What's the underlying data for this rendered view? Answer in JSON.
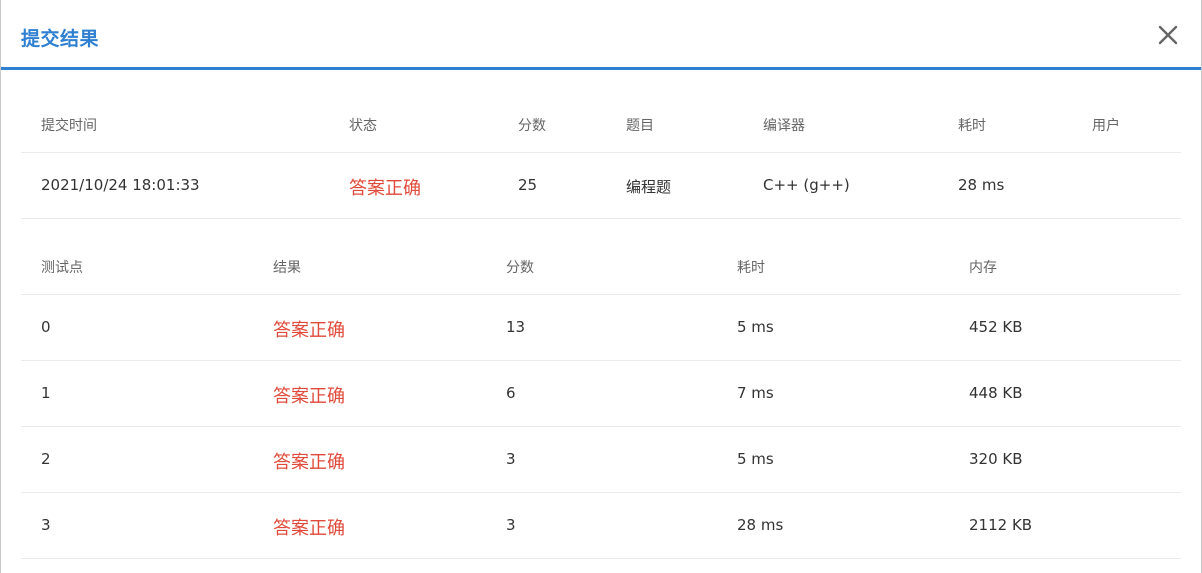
{
  "dialog": {
    "title": "提交结果",
    "close_icon": "close-icon"
  },
  "summary": {
    "columns": [
      "提交时间",
      "状态",
      "分数",
      "题目",
      "编译器",
      "耗时",
      "用户"
    ],
    "row": {
      "time": "2021/10/24 18:01:33",
      "status": "答案正确",
      "score": "25",
      "problem": "编程题",
      "compiler": "C++ (g++)",
      "duration": "28 ms",
      "user": ""
    }
  },
  "testcases": {
    "columns": [
      "测试点",
      "结果",
      "分数",
      "耗时",
      "内存"
    ],
    "rows": [
      {
        "id": "0",
        "result": "答案正确",
        "score": "13",
        "time": "5 ms",
        "memory": "452 KB"
      },
      {
        "id": "1",
        "result": "答案正确",
        "score": "6",
        "time": "7 ms",
        "memory": "448 KB"
      },
      {
        "id": "2",
        "result": "答案正确",
        "score": "3",
        "time": "5 ms",
        "memory": "320 KB"
      },
      {
        "id": "3",
        "result": "答案正确",
        "score": "3",
        "time": "28 ms",
        "memory": "2112 KB"
      }
    ]
  },
  "colors": {
    "accent": "#2f80d1",
    "status_ok": "#e04a3a"
  }
}
